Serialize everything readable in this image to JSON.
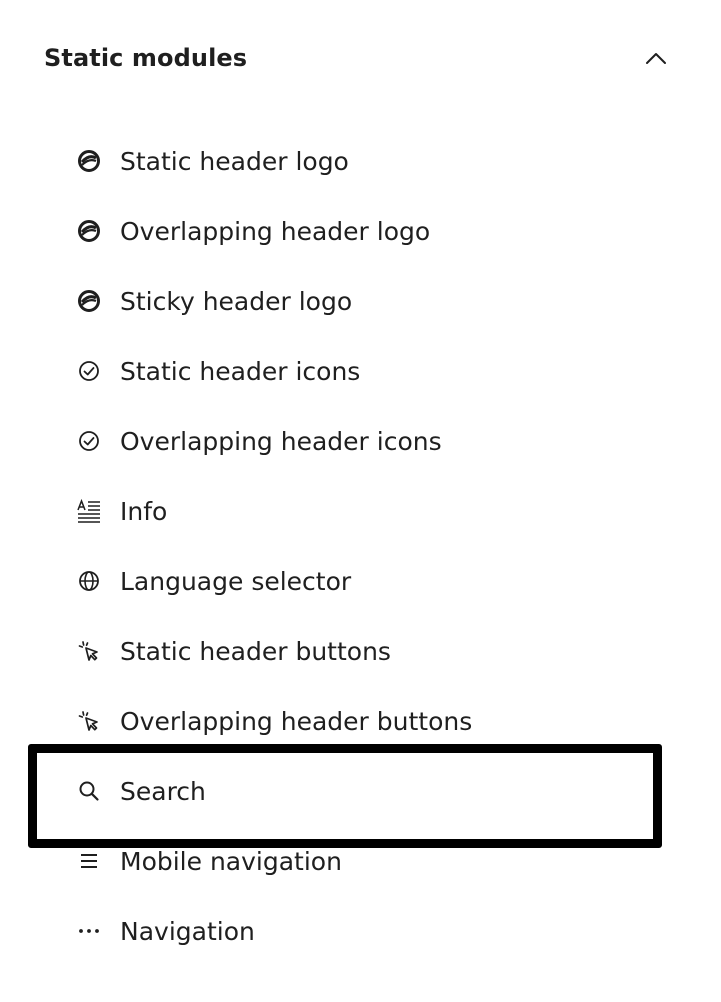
{
  "section": {
    "title": "Static modules",
    "toggle_icon": "chevron-up-icon"
  },
  "modules": [
    {
      "label": "Static header logo",
      "icon": "logo-icon"
    },
    {
      "label": "Overlapping header logo",
      "icon": "logo-icon"
    },
    {
      "label": "Sticky header logo",
      "icon": "logo-icon"
    },
    {
      "label": "Static header icons",
      "icon": "check-circle-icon"
    },
    {
      "label": "Overlapping header icons",
      "icon": "check-circle-icon"
    },
    {
      "label": "Info",
      "icon": "text-format-icon"
    },
    {
      "label": "Language selector",
      "icon": "globe-icon"
    },
    {
      "label": "Static header buttons",
      "icon": "cursor-click-icon"
    },
    {
      "label": "Overlapping header buttons",
      "icon": "cursor-click-icon"
    },
    {
      "label": "Search",
      "icon": "search-icon",
      "highlighted": true
    },
    {
      "label": "Mobile navigation",
      "icon": "hamburger-menu-icon"
    },
    {
      "label": "Navigation",
      "icon": "more-horizontal-icon"
    }
  ],
  "colors": {
    "text": "#1f1f1f",
    "highlight_border": "#000000",
    "background": "#ffffff"
  }
}
